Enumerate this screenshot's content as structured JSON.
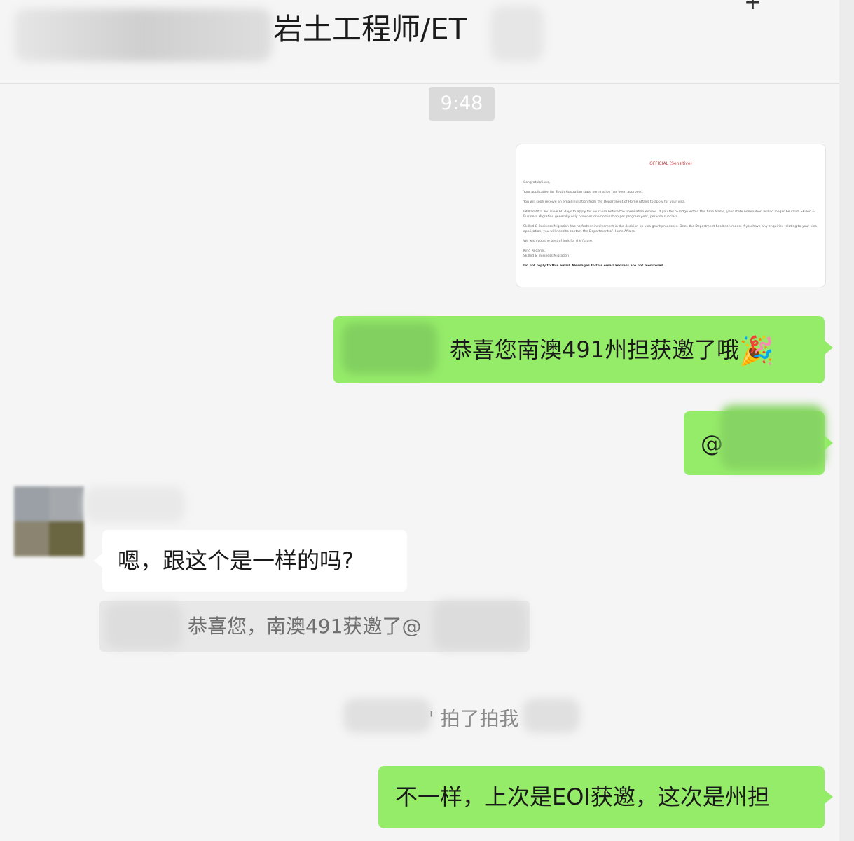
{
  "header": {
    "title": "岩土工程师/ET",
    "plus_icon": "plus-icon"
  },
  "chat": {
    "timestamp": "9:48",
    "document_preview": {
      "heading": "OFFICIAL (Sensitive)",
      "lines": [
        "Congratulations,",
        "Your application for South Australian state nomination has been approved.",
        "You will soon receive an email invitation from the Department of Home Affairs to apply for your visa.",
        "IMPORTANT: You have 60 days to apply for your visa before the nomination expires. If you fail to lodge within this time frame, your state nomination will no longer be valid. Skilled & Business Migration generally only provides one nomination per program year, per visa subclass.",
        "Skilled & Business Migration has no further involvement in the decision on visa grant processes. Once the Department has been made, if you have any enquiries relating to your visa application, you will need to contact the Department of Home Affairs.",
        "We wish you the best of luck for the future.",
        "Kind Regards,",
        "Skilled & Business Migration",
        "Do not reply to this email. Messages to this email address are not monitored."
      ]
    },
    "messages": [
      {
        "side": "right",
        "text": "恭喜您南澳491州担获邀了哦",
        "emoji": "🎉",
        "emoji_icon": "party-popper-icon"
      },
      {
        "side": "right",
        "text": "@"
      },
      {
        "side": "left",
        "text": "嗯，跟这个是一样的吗?"
      },
      {
        "side": "right",
        "text": "不一样，上次是EOI获邀，这次是州担"
      }
    ],
    "quote": {
      "text": "恭喜您，南澳491获邀了@"
    },
    "system_notice": {
      "text": "' 拍了拍我"
    }
  }
}
